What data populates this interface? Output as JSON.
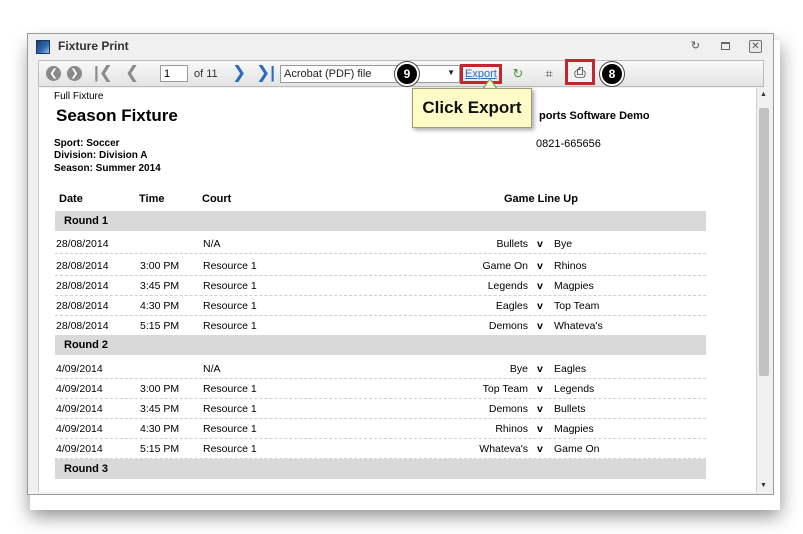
{
  "window": {
    "title": "Fixture Print"
  },
  "toolbar": {
    "page_value": "1",
    "page_of": "of 11",
    "export_format": "Acrobat (PDF) file",
    "export_label": "Export",
    "callout_export_num": "9",
    "callout_print_num": "8"
  },
  "tooltip": {
    "text": "Click Export"
  },
  "report": {
    "label": "Full Fixture",
    "title": "Season Fixture",
    "sport": "Sport: Soccer",
    "division": "Division: Division A",
    "season": "Season: Summer 2014",
    "org_name": "ports Software Demo",
    "phone": "0821-665656",
    "columns": {
      "date": "Date",
      "time": "Time",
      "court": "Court",
      "lineup": "Game Line Up"
    },
    "vs": "v",
    "rounds": [
      {
        "name": "Round 1",
        "games": [
          {
            "date": "28/08/2014",
            "time": "",
            "court": "N/A",
            "home": "Bullets",
            "away": "Bye"
          },
          {
            "date": "28/08/2014",
            "time": "3:00 PM",
            "court": "Resource 1",
            "home": "Game On",
            "away": "Rhinos"
          },
          {
            "date": "28/08/2014",
            "time": "3:45 PM",
            "court": "Resource 1",
            "home": "Legends",
            "away": "Magpies"
          },
          {
            "date": "28/08/2014",
            "time": "4:30 PM",
            "court": "Resource 1",
            "home": "Eagles",
            "away": "Top Team"
          },
          {
            "date": "28/08/2014",
            "time": "5:15 PM",
            "court": "Resource 1",
            "home": "Demons",
            "away": "Whateva's"
          }
        ]
      },
      {
        "name": "Round 2",
        "games": [
          {
            "date": "4/09/2014",
            "time": "",
            "court": "N/A",
            "home": "Bye",
            "away": "Eagles"
          },
          {
            "date": "4/09/2014",
            "time": "3:00 PM",
            "court": "Resource 1",
            "home": "Top Team",
            "away": "Legends"
          },
          {
            "date": "4/09/2014",
            "time": "3:45 PM",
            "court": "Resource 1",
            "home": "Demons",
            "away": "Bullets"
          },
          {
            "date": "4/09/2014",
            "time": "4:30 PM",
            "court": "Resource 1",
            "home": "Rhinos",
            "away": "Magpies"
          },
          {
            "date": "4/09/2014",
            "time": "5:15 PM",
            "court": "Resource 1",
            "home": "Whateva's",
            "away": "Game On"
          }
        ]
      },
      {
        "name": "Round 3",
        "games": []
      }
    ]
  },
  "colors": {
    "highlight_border": "#c0282d",
    "tooltip_bg": "#fdfbc8",
    "round_bar_bg": "#d9d9d9",
    "nav_blue": "#2f6cc0"
  }
}
